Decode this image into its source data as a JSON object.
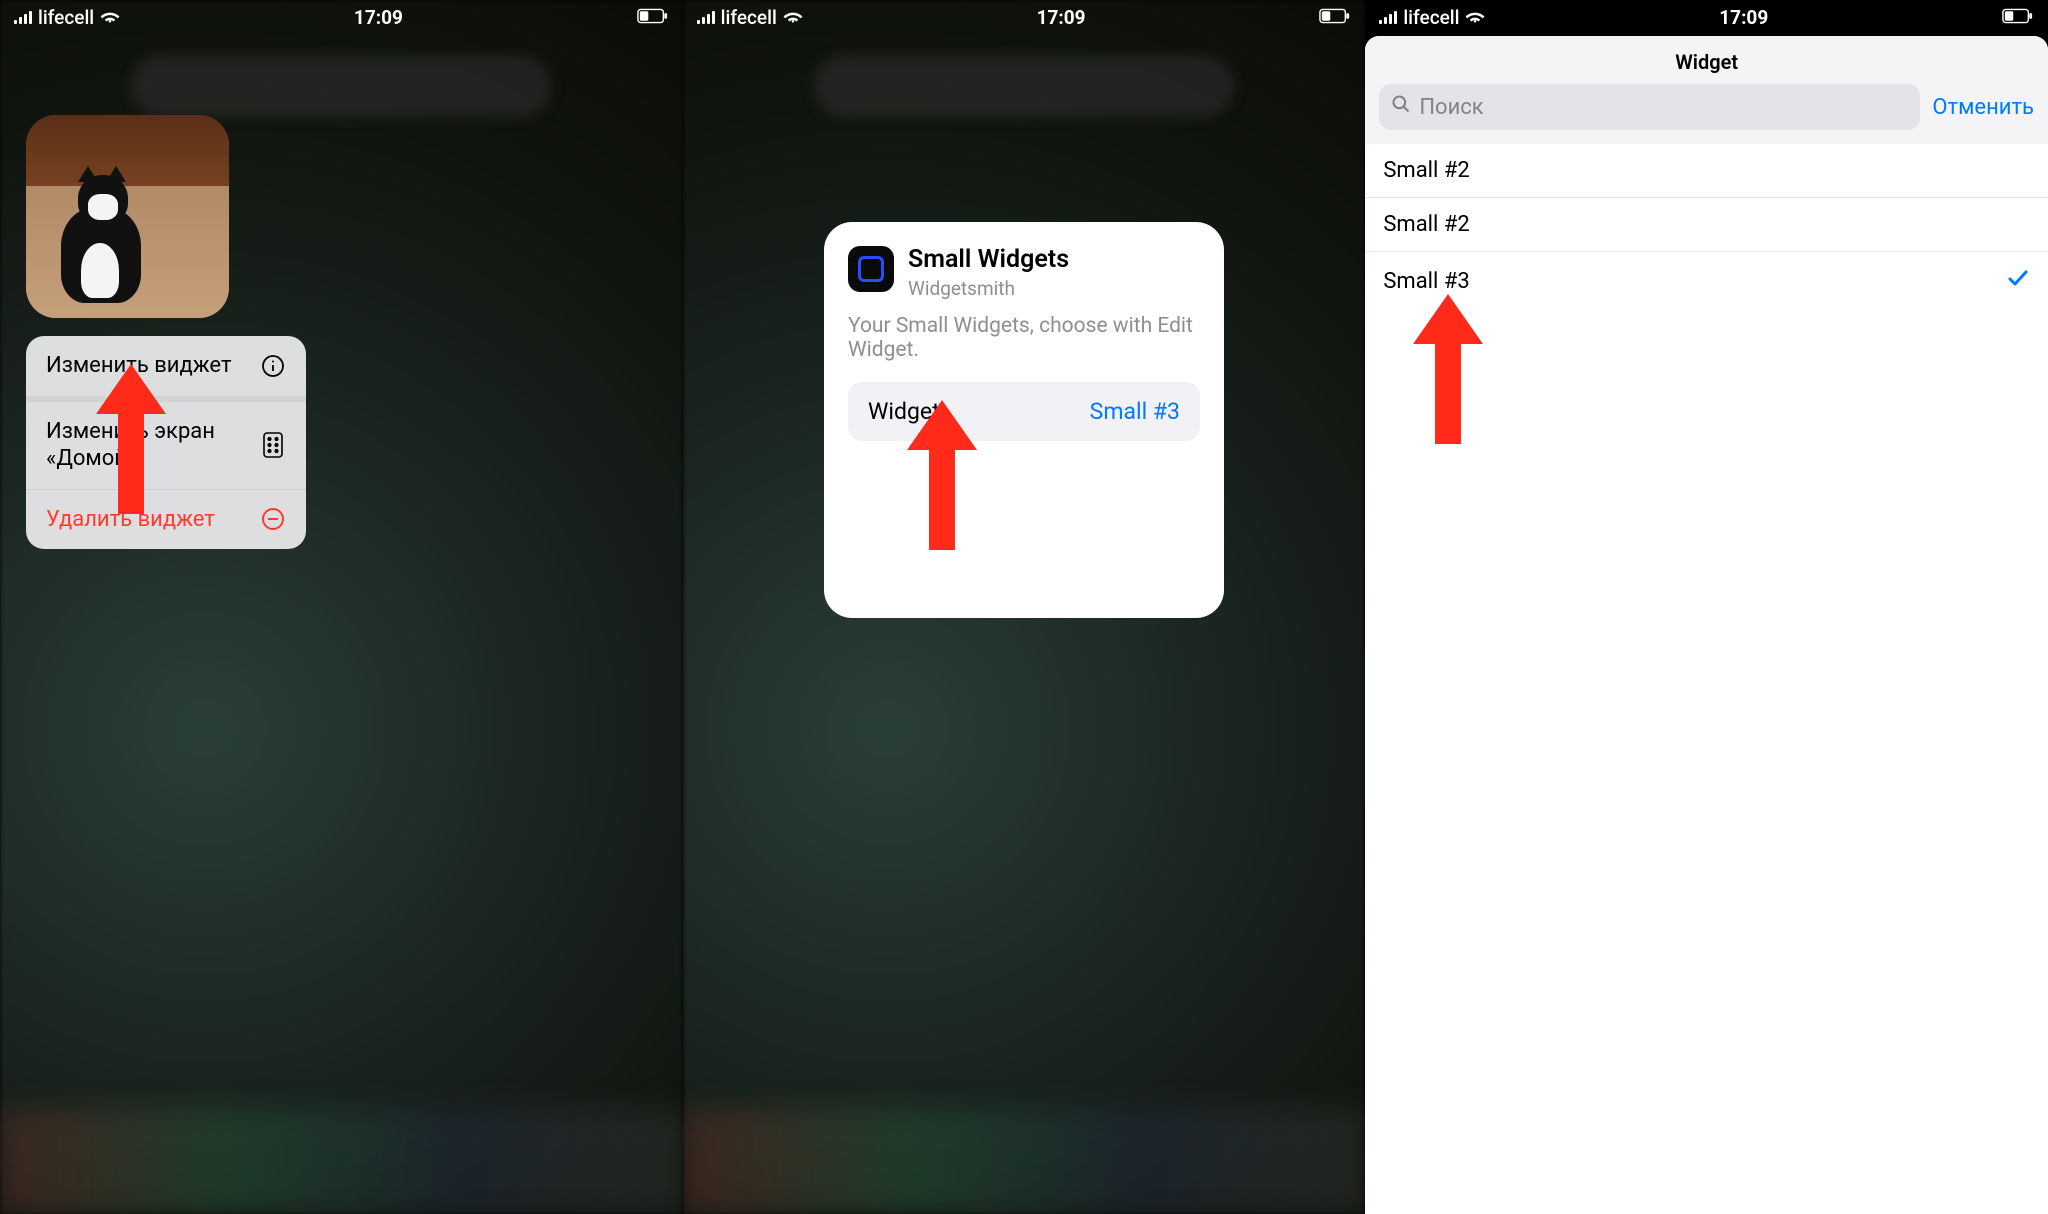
{
  "screens": [
    {
      "status": {
        "carrier": "lifecell",
        "time": "17:09"
      },
      "context_menu": {
        "edit_widget": "Изменить виджет",
        "edit_home": "Изменить экран «Домой»",
        "remove": "Удалить виджет"
      }
    },
    {
      "status": {
        "carrier": "lifecell",
        "time": "17:09"
      },
      "card": {
        "title": "Small Widgets",
        "app": "Widgetsmith",
        "desc": "Your Small Widgets, choose with Edit Widget.",
        "row_label": "Widget",
        "row_value": "Small #3"
      }
    },
    {
      "status": {
        "carrier": "lifecell",
        "time": "17:09"
      },
      "sheet": {
        "title": "Widget",
        "search_placeholder": "Поиск",
        "cancel": "Отменить",
        "items": [
          {
            "label": "Small #2",
            "selected": false
          },
          {
            "label": "Small #2",
            "selected": false
          },
          {
            "label": "Small #3",
            "selected": true
          }
        ]
      }
    }
  ]
}
